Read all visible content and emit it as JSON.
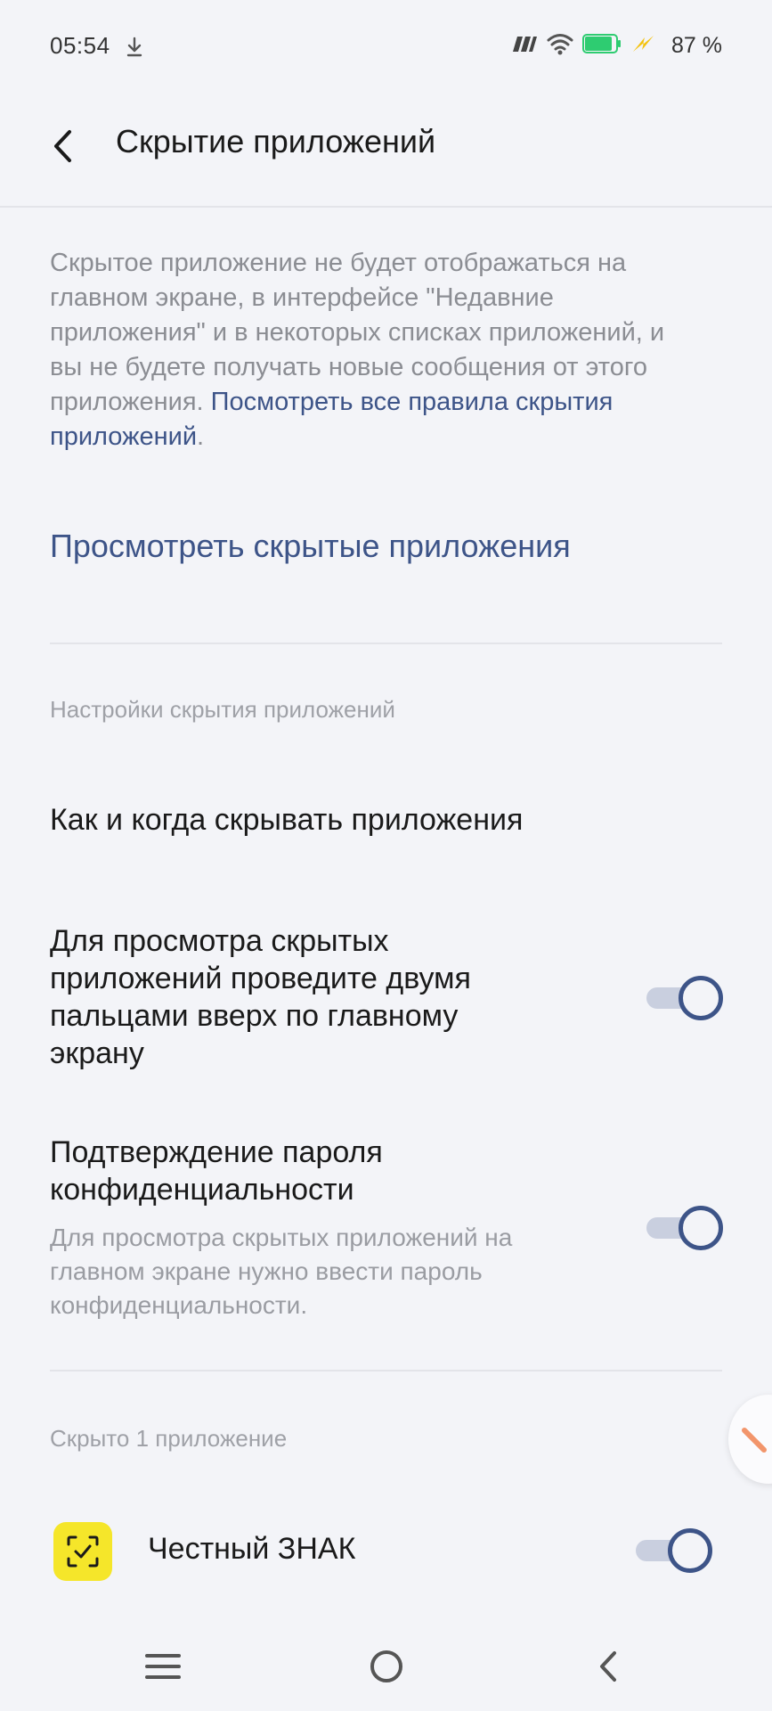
{
  "status_bar": {
    "time": "05:54",
    "battery_percent": "87 %",
    "battery_level": 0.87,
    "battery_color": "#2ecc71",
    "charging_color": "#f4c20d",
    "icons": [
      "download-icon",
      "carrier-icon",
      "wifi-icon",
      "battery-icon",
      "charging-icon"
    ]
  },
  "header": {
    "title": "Скрытие приложений"
  },
  "description": {
    "text": "Скрытое приложение не будет отображаться на главном экране, в интерфейсе \"Недавние приложения\" и в некоторых списках приложений, и вы не будете получать новые сообщения от этого приложения. ",
    "link_text": "Посмотреть все правила скрытия приложений",
    "trailing": "."
  },
  "view_hidden_label": "Просмотреть скрытые приложения",
  "settings_section": {
    "header": "Настройки скрытия приложений",
    "how_when_label": "Как и когда скрывать приложения",
    "swipe_toggle": {
      "label": "Для просмотра скрытых приложений проведите двумя пальцами вверх по главному экрану",
      "enabled": true
    },
    "password_toggle": {
      "label": "Подтверждение пароля конфиденциальности",
      "description": "Для просмотра скрытых приложений на главном экране нужно ввести пароль конфиденциальности.",
      "enabled": true
    }
  },
  "hidden_apps_section": {
    "header": "Скрыто 1 приложение",
    "apps": [
      {
        "name": "Честный ЗНАК",
        "hidden": true,
        "icon": "chestny-znak-icon",
        "icon_color": "#f5e62a"
      }
    ]
  },
  "accent_color": "#3d5488",
  "nav_bar": {
    "buttons": [
      "menu-icon",
      "home-icon",
      "back-icon"
    ]
  }
}
